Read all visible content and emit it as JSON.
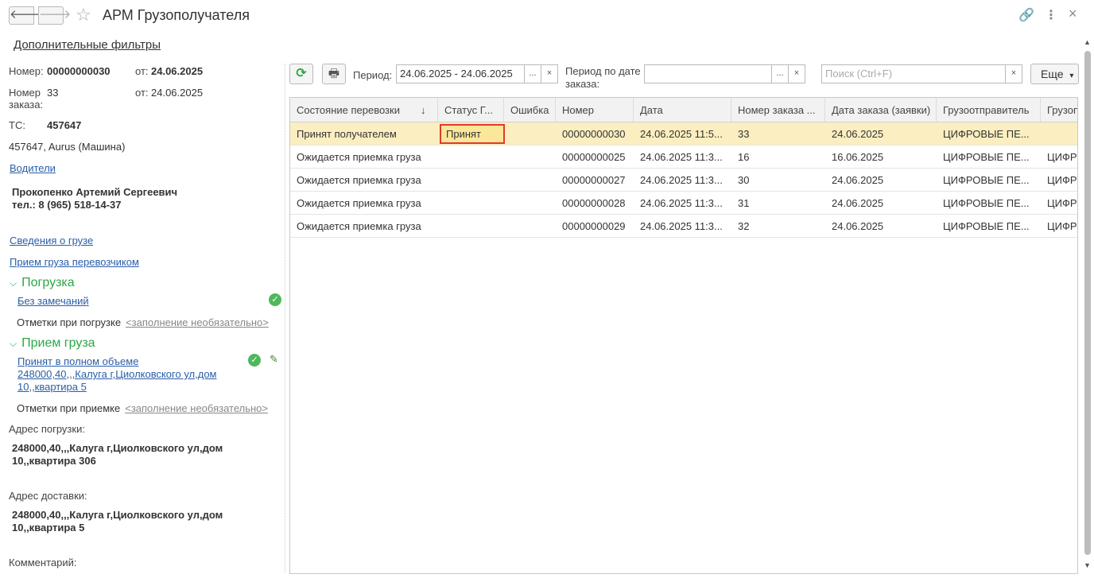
{
  "window": {
    "title": "АРМ Грузополучателя",
    "back_icon": "🡐",
    "forward_icon": "🡒",
    "star_icon": "☆",
    "link_icon": "🔗",
    "menu_icon": "⋮",
    "close_icon": "×"
  },
  "left": {
    "filters_link": "Дополнительные фильтры",
    "number_label": "Номер:",
    "number_value": "00000000030",
    "from_label": "от:",
    "date_value": "24.06.2025",
    "order_number_label_1": "Номер",
    "order_number_label_2": "заказа:",
    "order_number_value": "33",
    "order_from_label": "от:",
    "order_date_value": "24.06.2025",
    "vehicle_label": "ТС:",
    "vehicle_value": "457647",
    "vehicle_desc": "457647, Aurus (Машина)",
    "drivers_link": "Водители",
    "driver_name": "Прокопенко Артемий Сергеевич",
    "driver_phone": "тел.: 8 (965) 518-14-37",
    "cargo_info_link": "Сведения о грузе",
    "cargo_carrier_link": "Прием груза перевозчиком",
    "loading_section": "Погрузка",
    "loading_status_link": "Без замечаний",
    "loading_marks_label": "Отметки при погрузке",
    "loading_marks_optional": "<заполнение необязательно>",
    "receive_section": "Прием груза",
    "receive_status_line1": "Принят в полном объеме",
    "receive_status_line2": "248000,40,,,Калуга г,Циолковского ул,дом",
    "receive_status_line3": "10,,квартира 5",
    "receive_marks_label": "Отметки при приемке",
    "receive_marks_optional": "<заполнение необязательно>",
    "loading_address_label": "Адрес погрузки:",
    "loading_address_line1": "248000,40,,,Калуга г,Циолковского ул,дом",
    "loading_address_line2": "10,,квартира 306",
    "delivery_address_label": "Адрес доставки:",
    "delivery_address_line1": "248000,40,,,Калуга г,Циолковского ул,дом",
    "delivery_address_line2": "10,,квартира 5",
    "comment_label": "Комментарий:",
    "check_icon": "✓",
    "pencil_icon": "✎",
    "chevron_icon": "⌵"
  },
  "toolbar": {
    "refresh_icon": "⟳",
    "print_icon": "🖶",
    "period_label": "Период:",
    "period_value": "24.06.2025 - 24.06.2025",
    "period_pick": "...",
    "period_clear": "×",
    "order_period_label_1": "Период по дате",
    "order_period_label_2": "заказа:",
    "order_period_value": "",
    "order_period_pick": "...",
    "order_period_clear": "×",
    "search_placeholder": "Поиск (Ctrl+F)",
    "search_clear": "×",
    "more_label": "Еще",
    "more_arrow": "▾"
  },
  "table": {
    "columns": [
      "Состояние перевозки",
      "Статус Г...",
      "Ошибка",
      "Номер",
      "Дата",
      "Номер заказа ...",
      "Дата заказа (заявки)",
      "Грузоотправитель",
      "Грузоп"
    ],
    "sort_icon": "↓",
    "rows": [
      [
        "Принят получателем",
        "Принят",
        "",
        "00000000030",
        "24.06.2025 11:5...",
        "33",
        "24.06.2025",
        "ЦИФРОВЫЕ ПЕ...",
        ""
      ],
      [
        "Ожидается приемка груза",
        "",
        "",
        "00000000025",
        "24.06.2025 11:3...",
        "16",
        "16.06.2025",
        "ЦИФРОВЫЕ ПЕ...",
        "ЦИФР"
      ],
      [
        "Ожидается приемка груза",
        "",
        "",
        "00000000027",
        "24.06.2025 11:3...",
        "30",
        "24.06.2025",
        "ЦИФРОВЫЕ ПЕ...",
        "ЦИФР"
      ],
      [
        "Ожидается приемка груза",
        "",
        "",
        "00000000028",
        "24.06.2025 11:3...",
        "31",
        "24.06.2025",
        "ЦИФРОВЫЕ ПЕ...",
        "ЦИФР"
      ],
      [
        "Ожидается приемка груза",
        "",
        "",
        "00000000029",
        "24.06.2025 11:3...",
        "32",
        "24.06.2025",
        "ЦИФРОВЫЕ ПЕ...",
        "ЦИФР"
      ]
    ]
  },
  "scrollbar": {
    "up_icon": "▲",
    "down_icon": "▼"
  }
}
